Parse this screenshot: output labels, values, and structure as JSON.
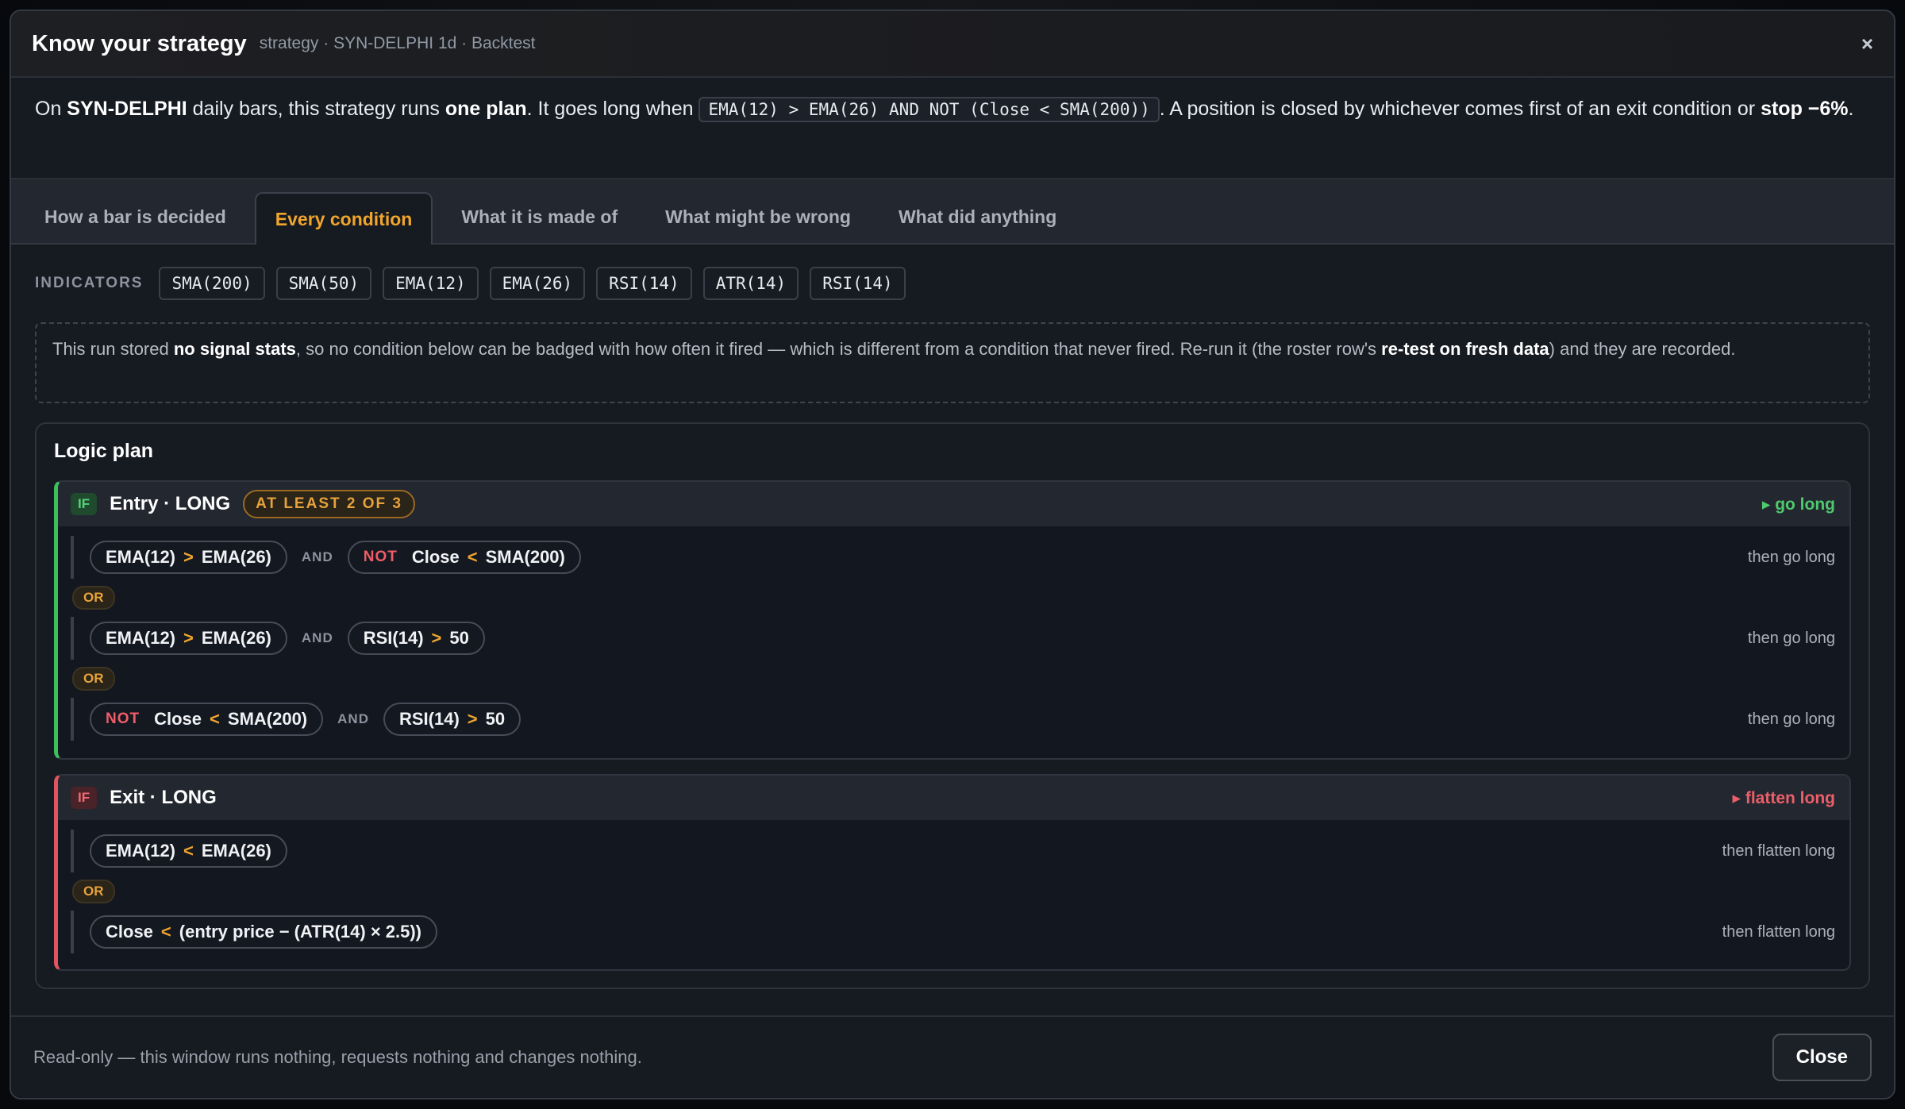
{
  "header": {
    "title": "Know your strategy",
    "subtitle": "strategy · SYN-DELPHI 1d · Backtest",
    "close_glyph": "×"
  },
  "summary": {
    "p1": "On ",
    "symbol": "SYN-DELPHI",
    "p2": " daily bars, this strategy runs ",
    "plan_count": "one plan",
    "p3": ". It goes long when ",
    "rule": "EMA(12) > EMA(26) AND NOT (Close < SMA(200))",
    "p4": ". A position is closed by whichever comes first of an exit condition or ",
    "stop": "stop −6%",
    "p5": "."
  },
  "tabs": [
    {
      "label": "How a bar is decided",
      "active": false
    },
    {
      "label": "Every condition",
      "active": true
    },
    {
      "label": "What it is made of",
      "active": false
    },
    {
      "label": "What might be wrong",
      "active": false
    },
    {
      "label": "What did anything",
      "active": false
    }
  ],
  "indicators": {
    "label": "INDICATORS",
    "items": [
      "SMA(200)",
      "SMA(50)",
      "EMA(12)",
      "EMA(26)",
      "RSI(14)",
      "ATR(14)",
      "RSI(14)"
    ]
  },
  "notice": {
    "p1": "This run stored ",
    "b1": "no signal stats",
    "p2": ", so no condition below can be badged with how often it fired — which is different from a condition that never fired. Re-run it (the roster row's ",
    "b2": "re-test on fresh data",
    "p3": ") and they are recorded."
  },
  "plan": {
    "title": "Logic plan",
    "entry": {
      "if": "IF",
      "title": "Entry · LONG",
      "badge": "AT LEAST 2 OF 3",
      "action": "▸ go long",
      "or_label": "OR",
      "and_label": "AND",
      "not_label": "NOT",
      "then": "then go long",
      "r1a": {
        "l": "EMA(12)",
        "op": ">",
        "r": "EMA(26)"
      },
      "r1b": {
        "l": "Close",
        "op": "<",
        "r": "SMA(200)"
      },
      "r2a": {
        "l": "EMA(12)",
        "op": ">",
        "r": "EMA(26)"
      },
      "r2b": {
        "l": "RSI(14)",
        "op": ">",
        "r": "50"
      },
      "r3a": {
        "l": "Close",
        "op": "<",
        "r": "SMA(200)"
      },
      "r3b": {
        "l": "RSI(14)",
        "op": ">",
        "r": "50"
      }
    },
    "exit": {
      "if": "IF",
      "title": "Exit · LONG",
      "action": "▸ flatten long",
      "or_label": "OR",
      "then": "then flatten long",
      "r1": {
        "l": "EMA(12)",
        "op": "<",
        "r": "EMA(26)"
      },
      "r2": {
        "l": "Close",
        "op": "<",
        "r": "(entry price − (ATR(14) × 2.5))"
      }
    }
  },
  "footer": {
    "text": "Read-only — this window runs nothing, requests nothing and changes nothing.",
    "close_label": "Close"
  },
  "colors": {
    "accent": "#f0a52d",
    "entry": "#3fbf5c",
    "exit": "#e0555f"
  }
}
